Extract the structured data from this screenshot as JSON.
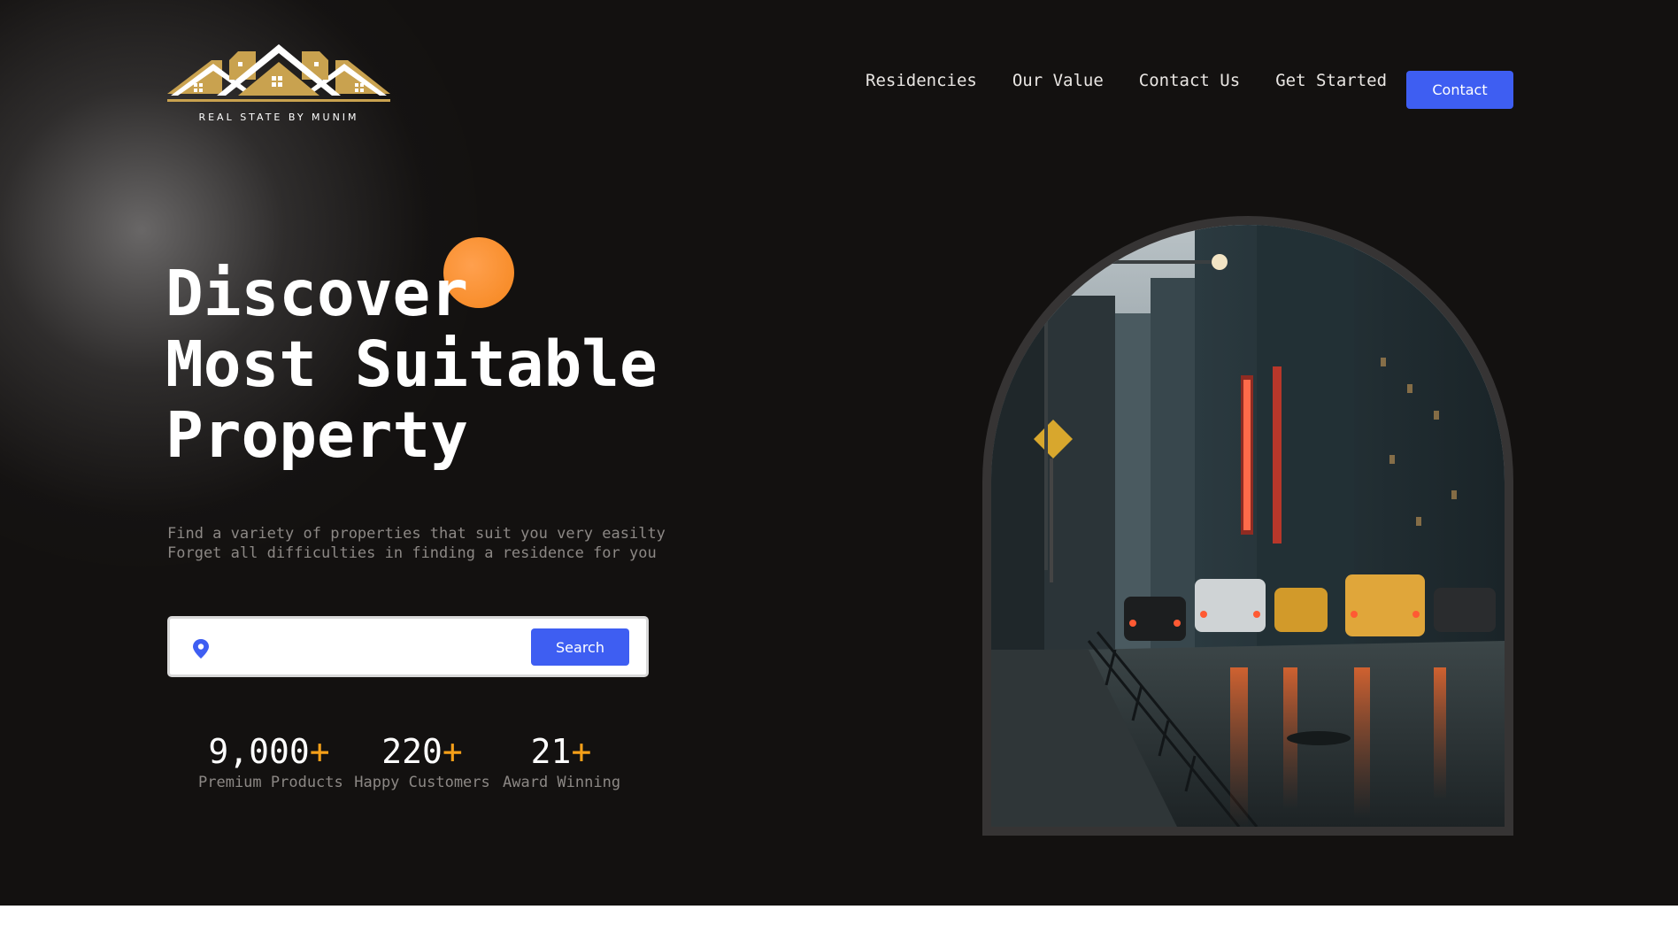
{
  "logo": {
    "text": "REAL STATE BY MUNIM",
    "colors": {
      "roof": "#c9a24f",
      "house": "#ffffff"
    }
  },
  "nav": {
    "items": [
      {
        "label": "Residencies"
      },
      {
        "label": "Our Value"
      },
      {
        "label": "Contact Us"
      },
      {
        "label": "Get Started"
      }
    ],
    "contact_label": "Contact"
  },
  "hero": {
    "title_lines": [
      "Discover",
      "Most Suitable",
      "Property"
    ],
    "subtitle_lines": [
      "Find a variety of properties that suit you very easilty",
      "Forget all difficulties in finding a residence for you"
    ]
  },
  "search": {
    "icon": "location-pin-icon",
    "value": "",
    "placeholder": "",
    "button_label": "Search"
  },
  "stats": [
    {
      "value": "9,000",
      "suffix": "+",
      "label": "Premium Products"
    },
    {
      "value": "220",
      "suffix": "+",
      "label": "Happy Customers"
    },
    {
      "value": "21",
      "suffix": "+",
      "label": "Award Winning"
    }
  ],
  "colors": {
    "background": "#131110",
    "accent_blue": "#3e5ef2",
    "accent_orange": "#f5a019",
    "muted_text": "#8c8885",
    "frame": "#363434"
  }
}
